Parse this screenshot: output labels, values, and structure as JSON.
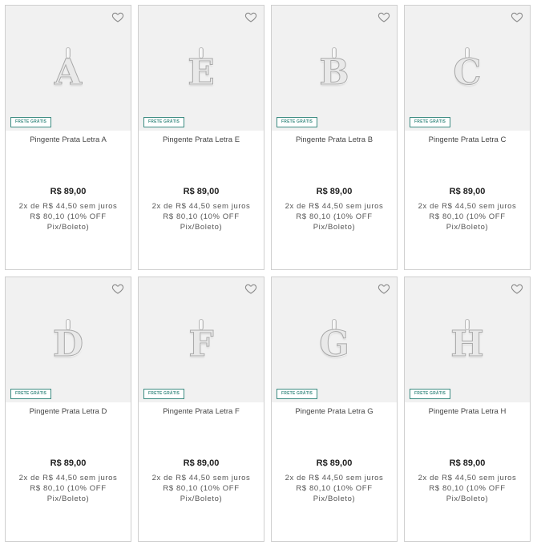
{
  "products": [
    {
      "letter": "A",
      "name": "Pingente Prata Letra A",
      "badge": "FRETE GRÁTIS",
      "price": "R$ 89,00",
      "installments": "2x de R$ 44,50 sem juros",
      "discount": "R$ 80,10 (10% OFF",
      "payment_method": "Pix/Boleto)",
      "favorite_icon": "heart-outline-icon"
    },
    {
      "letter": "E",
      "name": "Pingente Prata Letra E",
      "badge": "FRETE GRÁTIS",
      "price": "R$ 89,00",
      "installments": "2x de R$ 44,50 sem juros",
      "discount": "R$ 80,10 (10% OFF",
      "payment_method": "Pix/Boleto)",
      "favorite_icon": "heart-outline-icon"
    },
    {
      "letter": "B",
      "name": "Pingente Prata Letra B",
      "badge": "FRETE GRÁTIS",
      "price": "R$ 89,00",
      "installments": "2x de R$ 44,50 sem juros",
      "discount": "R$ 80,10 (10% OFF",
      "payment_method": "Pix/Boleto)",
      "favorite_icon": "heart-outline-icon"
    },
    {
      "letter": "C",
      "name": "Pingente Prata Letra C",
      "badge": "FRETE GRÁTIS",
      "price": "R$ 89,00",
      "installments": "2x de R$ 44,50 sem juros",
      "discount": "R$ 80,10 (10% OFF",
      "payment_method": "Pix/Boleto)",
      "favorite_icon": "heart-outline-icon"
    },
    {
      "letter": "D",
      "name": "Pingente Prata Letra D",
      "badge": "FRETE GRÁTIS",
      "price": "R$ 89,00",
      "installments": "2x de R$ 44,50 sem juros",
      "discount": "R$ 80,10 (10% OFF",
      "payment_method": "Pix/Boleto)",
      "favorite_icon": "heart-outline-icon"
    },
    {
      "letter": "F",
      "name": "Pingente Prata Letra F",
      "badge": "FRETE GRÁTIS",
      "price": "R$ 89,00",
      "installments": "2x de R$ 44,50 sem juros",
      "discount": "R$ 80,10 (10% OFF",
      "payment_method": "Pix/Boleto)",
      "favorite_icon": "heart-outline-icon"
    },
    {
      "letter": "G",
      "name": "Pingente Prata Letra G",
      "badge": "FRETE GRÁTIS",
      "price": "R$ 89,00",
      "installments": "2x de R$ 44,50 sem juros",
      "discount": "R$ 80,10 (10% OFF",
      "payment_method": "Pix/Boleto)",
      "favorite_icon": "heart-outline-icon"
    },
    {
      "letter": "H",
      "name": "Pingente Prata Letra H",
      "badge": "FRETE GRÁTIS",
      "price": "R$ 89,00",
      "installments": "2x de R$ 44,50 sem juros",
      "discount": "R$ 80,10 (10% OFF",
      "payment_method": "Pix/Boleto)",
      "favorite_icon": "heart-outline-icon"
    }
  ],
  "colors": {
    "badge": "#3d8c82",
    "image_background": "#f1f1f1",
    "border": "#cfcfcf"
  }
}
